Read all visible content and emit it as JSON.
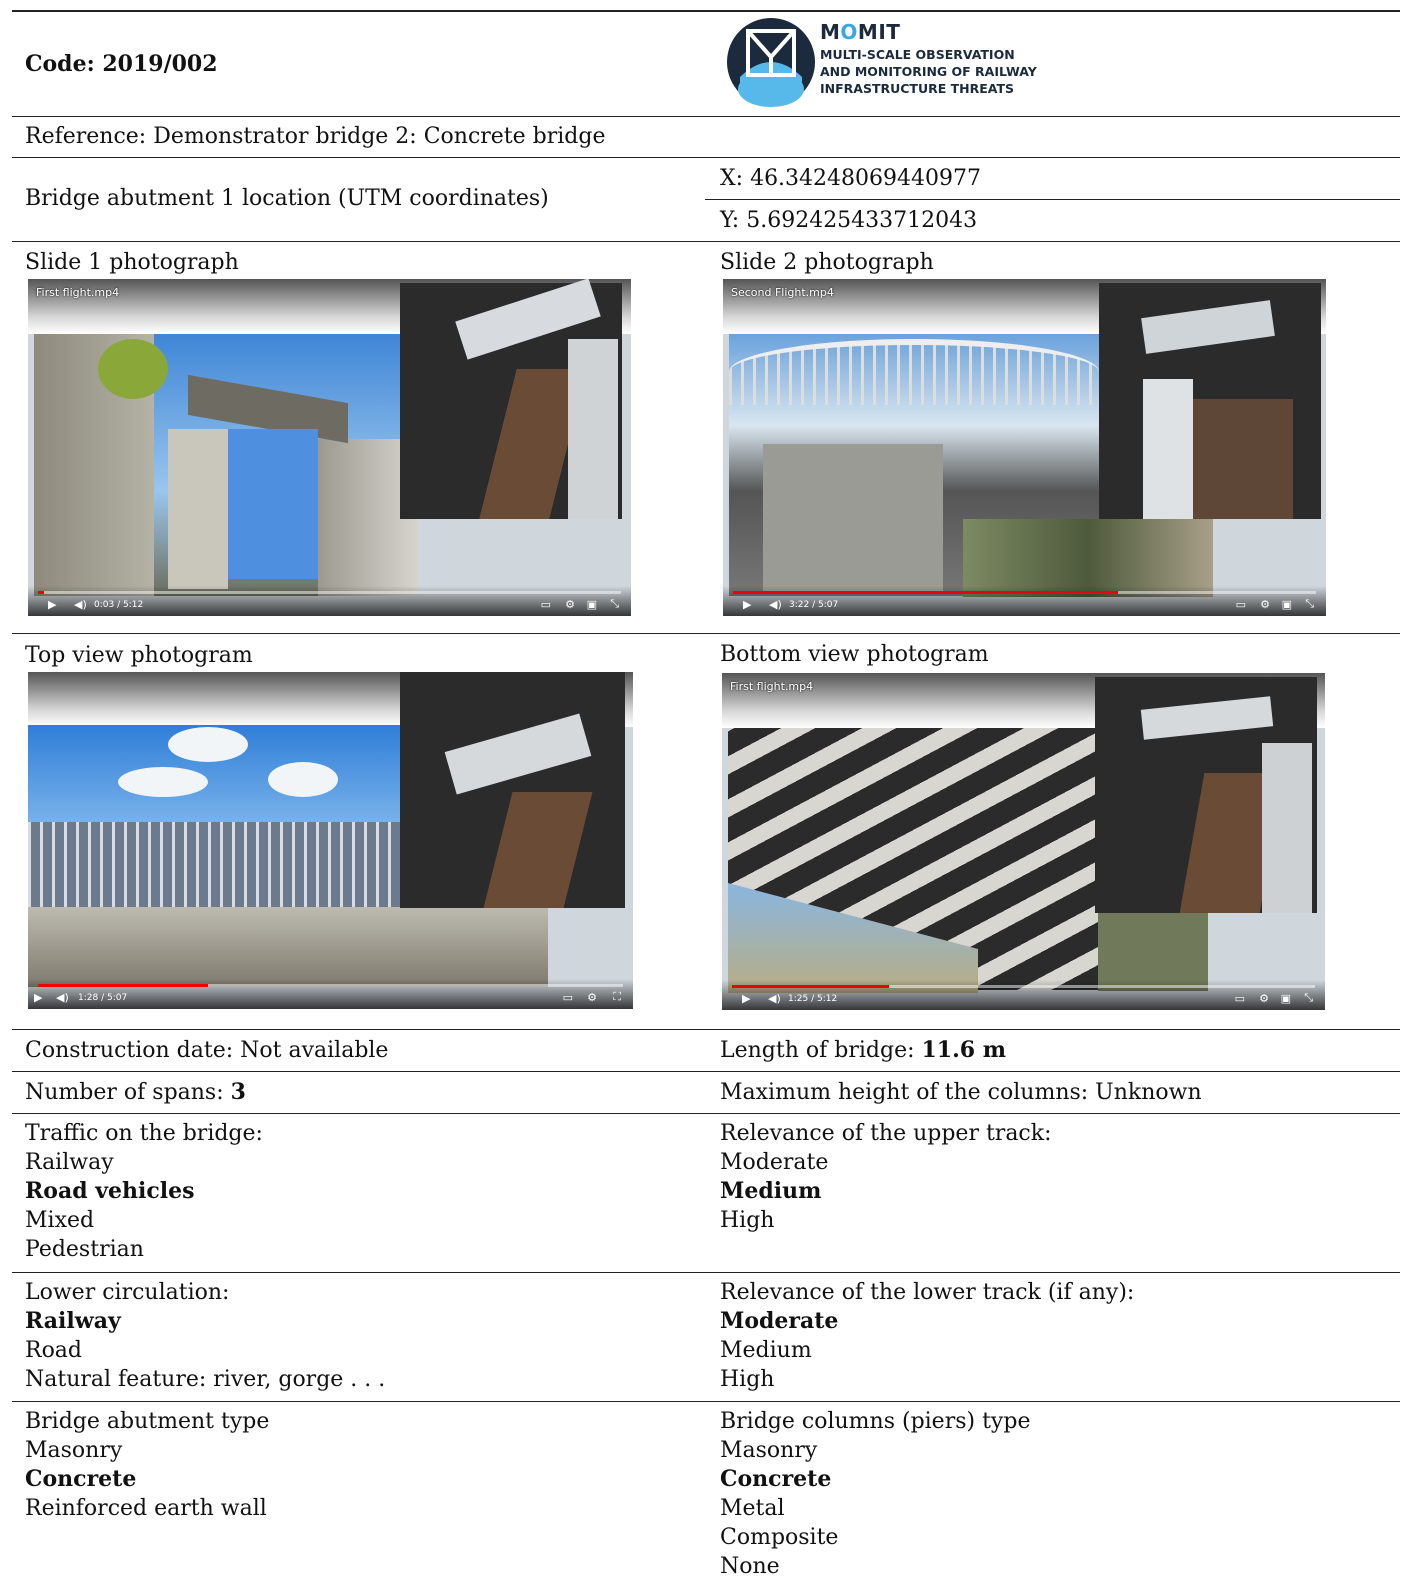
{
  "header": {
    "code": "Code: 2019/002",
    "logo": {
      "title_pre": "M",
      "title_o": "O",
      "title_post": "MIT",
      "sub_lines": [
        "MULTI-SCALE OBSERVATION",
        "AND MONITORING OF RAILWAY",
        "INFRASTRUCTURE THREATS"
      ]
    }
  },
  "reference": "Reference: Demonstrator bridge 2: Concrete bridge",
  "location": {
    "label": "Bridge abutment 1 location (UTM coordinates)",
    "x": "X: 46.34248069440977",
    "y": "Y: 5.692425433712043"
  },
  "photos": {
    "slide1": {
      "caption": "Slide 1 photograph",
      "video_title": "First flight.mp4",
      "time": "0:03 / 5:12",
      "progress": 0.01
    },
    "slide2": {
      "caption": "Slide 2 photograph",
      "video_title": "Second Flight.mp4",
      "time": "3:22 / 5:07",
      "progress": 0.66
    },
    "top": {
      "caption": "Top view photogram",
      "video_title": "",
      "time": "1:28 / 5:07",
      "progress": 0.29
    },
    "bottom": {
      "caption": "Bottom view photogram",
      "video_title": "First flight.mp4",
      "time": "1:25 / 5:12",
      "progress": 0.27
    }
  },
  "details": {
    "construction_date": "Construction date: Not available",
    "length_label": "Length of bridge: ",
    "length_value": "11.6 m",
    "spans_label": "Number of spans: ",
    "spans_value": "3",
    "max_height": "Maximum height of the columns: Unknown",
    "traffic": {
      "label": "Traffic on the bridge:",
      "options": [
        "Railway",
        "Road vehicles",
        "Mixed",
        "Pedestrian"
      ],
      "selected": "Road vehicles"
    },
    "upper_relevance": {
      "label": "Relevance of the upper track:",
      "options": [
        "Moderate",
        "Medium",
        "High"
      ],
      "selected": "Medium"
    },
    "lower_circulation": {
      "label": "Lower circulation:",
      "options": [
        "Railway",
        "Road",
        "Natural feature: river, gorge . . ."
      ],
      "selected": "Railway"
    },
    "lower_relevance": {
      "label": "Relevance of the lower track (if any):",
      "options": [
        "Moderate",
        "Medium",
        "High"
      ],
      "selected": "Moderate"
    },
    "abutment_type": {
      "label": "Bridge abutment type",
      "options": [
        "Masonry",
        "Concrete",
        "Reinforced earth wall"
      ],
      "selected": "Concrete"
    },
    "piers_type": {
      "label": "Bridge columns (piers) type",
      "options": [
        "Masonry",
        "Concrete",
        "Metal",
        "Composite",
        "None"
      ],
      "selected": "Concrete"
    }
  },
  "colors": {
    "logo_dark": "#1b2a3d",
    "logo_accent": "#3aa7e3",
    "progress_red": "#e00000"
  }
}
